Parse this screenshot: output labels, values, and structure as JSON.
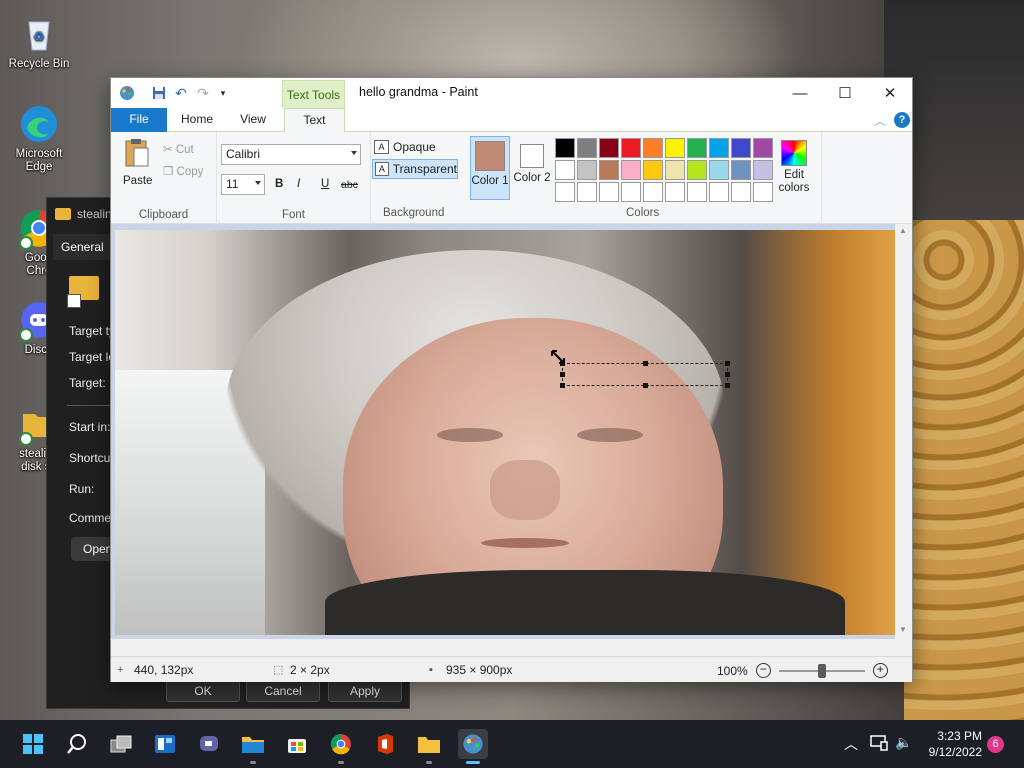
{
  "desktop": {
    "icons": [
      {
        "label_lines": [
          "Recycle Bin"
        ]
      },
      {
        "label_lines": [
          "Microsoft",
          "Edge"
        ]
      },
      {
        "label_lines": [
          "Goog",
          "Chro"
        ]
      },
      {
        "label_lines": [
          "Disco"
        ]
      },
      {
        "label_lines": [
          "stealing",
          "disk sp"
        ]
      }
    ]
  },
  "properties_dialog": {
    "title": "stealin",
    "tab": "General",
    "labels": [
      "Target ty",
      "Target lo",
      "Target:",
      "Start in:",
      "Shortcut",
      "Run:",
      "Commen"
    ],
    "open_button": "Open",
    "ok": "OK",
    "cancel": "Cancel",
    "apply": "Apply"
  },
  "paint": {
    "context_tab": "Text Tools",
    "title": "hello grandma - Paint",
    "tabs": {
      "file": "File",
      "home": "Home",
      "view": "View",
      "text": "Text"
    },
    "clipboard": {
      "paste": "Paste",
      "cut": "Cut",
      "copy": "Copy",
      "label": "Clipboard"
    },
    "font": {
      "family": "Calibri",
      "size": "11",
      "bold": "B",
      "italic": "I",
      "underline": "U",
      "strike": "abc",
      "label": "Font"
    },
    "background": {
      "opaque": "Opaque",
      "transparent": "Transparent",
      "label": "Background"
    },
    "colors": {
      "color1_label": "Color 1",
      "color1_value": "#c08a74",
      "color2_label": "Color 2",
      "color2_value": "#ffffff",
      "edit_label": "Edit colors",
      "label": "Colors",
      "palette": [
        "#000000",
        "#7f7f7f",
        "#880015",
        "#ed1c24",
        "#ff7f27",
        "#fff200",
        "#22b14c",
        "#00a2e8",
        "#3f48cc",
        "#a349a4",
        "#ffffff",
        "#c3c3c3",
        "#b97a57",
        "#ffaec9",
        "#ffc90e",
        "#efe4b0",
        "#b5e61d",
        "#99d9ea",
        "#7092be",
        "#c8bfe7",
        "#ffffff",
        "#ffffff",
        "#ffffff",
        "#ffffff",
        "#ffffff",
        "#ffffff",
        "#ffffff",
        "#ffffff",
        "#ffffff",
        "#ffffff"
      ]
    },
    "status": {
      "cursor_pos": "440, 132px",
      "selection_size": "2 × 2px",
      "image_size": "935 × 900px",
      "zoom": "100%",
      "zoom_fraction": 0.5
    }
  },
  "taskbar": {
    "time": "3:23 PM",
    "date": "9/12/2022",
    "notification_count": "6"
  }
}
